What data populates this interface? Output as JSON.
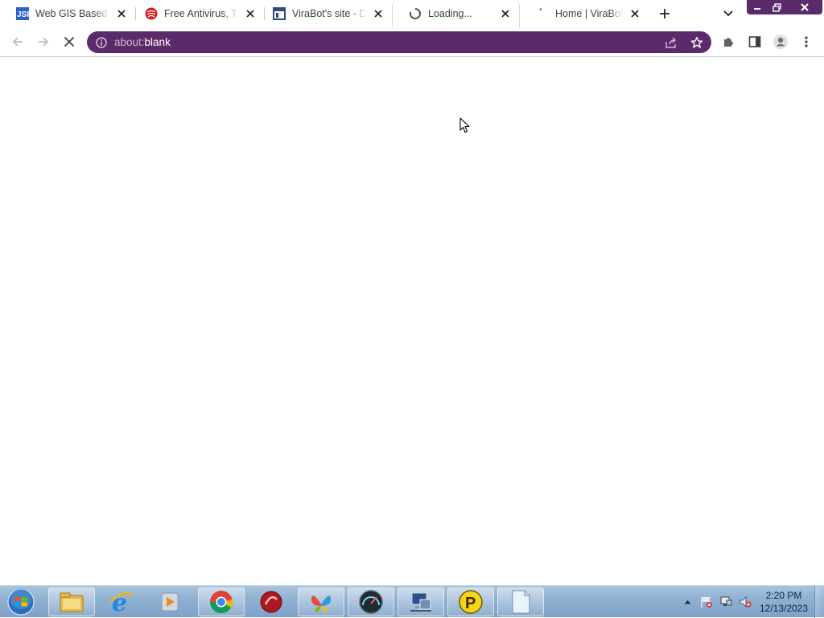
{
  "browser": {
    "tabs": [
      {
        "title": "Web GIS Based O",
        "favicon": "jsf-logo-icon"
      },
      {
        "title": "Free Antivirus, Tur",
        "favicon": "trend-micro-icon"
      },
      {
        "title": "ViraBot's site - Do",
        "favicon": "site-layout-icon"
      },
      {
        "title": "Loading...",
        "favicon": "loading-spinner-icon",
        "active": true
      },
      {
        "title": "Home | ViraBot's s",
        "favicon": "loading-dot-icon"
      }
    ],
    "address_bar": {
      "scheme": "about:",
      "host": "blank"
    },
    "theme": {
      "omnibox_bg": "#5b2a6b",
      "window_controls_bg": "#5a2a6a"
    }
  },
  "taskbar": {
    "pinned": [
      "file-explorer-icon",
      "internet-explorer-icon",
      "media-player-icon",
      "chrome-icon",
      "red-circle-app-icon",
      "msn-butterfly-icon",
      "speedometer-icon",
      "network-computer-icon",
      "p-yellow-app-icon",
      "blank-document-icon"
    ],
    "clock": {
      "time": "2:20 PM",
      "date": "12/13/2023"
    }
  }
}
